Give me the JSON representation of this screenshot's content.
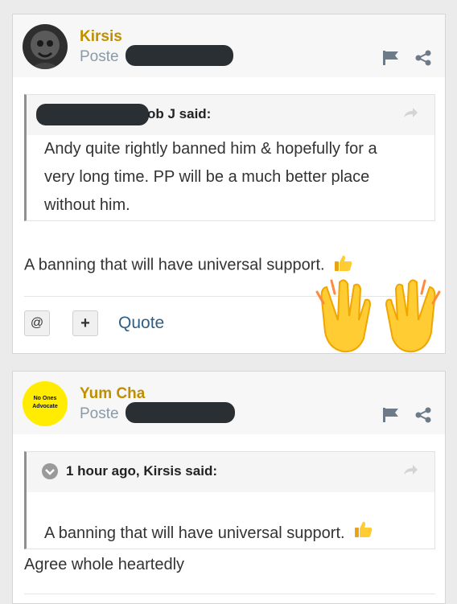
{
  "post1": {
    "username": "Kirsis",
    "posted_prefix": "Poste",
    "quote": {
      "attribution_visible": "ob J said:",
      "text_lines": [
        "Andy quite rightly banned him & hopefully for a",
        "very long time. PP will be a much better place",
        "without him."
      ]
    },
    "body": "A banning that will have universal support.",
    "actions": {
      "mention_label": "@",
      "multiquote_label": "+",
      "quote_label": "Quote"
    }
  },
  "post2": {
    "username": "Yum Cha",
    "posted_prefix": "Poste",
    "avatar_text_line1": "No Ones",
    "avatar_text_line2": "Advocate",
    "quote": {
      "attribution": "1 hour ago, Kirsis said:",
      "text": "A banning that will have universal support."
    },
    "body": "Agree whole heartedly"
  },
  "colors": {
    "username": "#bf8f00",
    "posted": "#8a9aa8",
    "quote_link": "#2f5f86",
    "avatar2_bg": "#ffec00",
    "emoji": "#ffcc33"
  },
  "icons": [
    "flag-icon",
    "share-icon",
    "reply-arrow-icon",
    "thumbs-up-icon",
    "chevron-icon",
    "raised-hands-icon"
  ]
}
